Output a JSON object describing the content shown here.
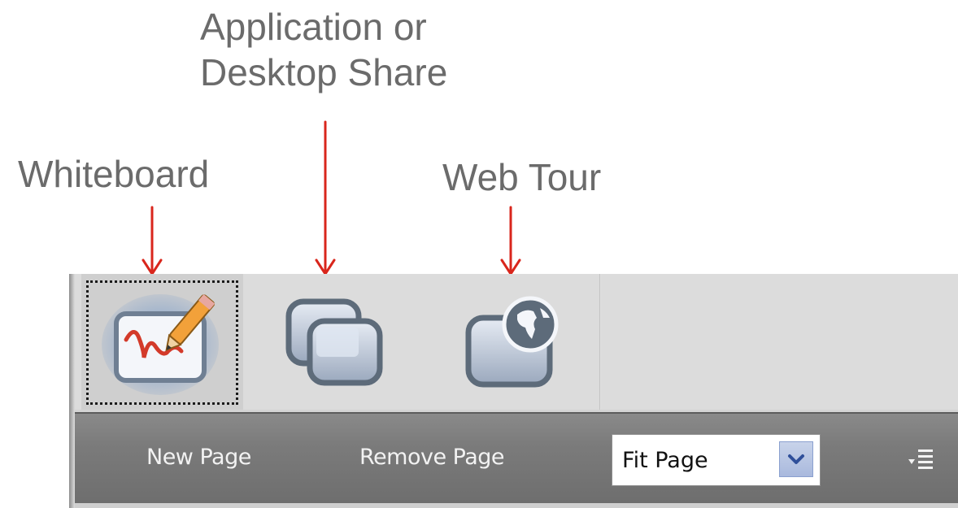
{
  "callouts": {
    "application_line1": "Application or",
    "application_line2": "Desktop Share",
    "whiteboard": "Whiteboard",
    "web_tour": "Web Tour"
  },
  "toolbar": {
    "icons": [
      {
        "name": "whiteboard-icon",
        "selected": true
      },
      {
        "name": "desktop-share-icon",
        "selected": false
      },
      {
        "name": "web-tour-icon",
        "selected": false
      }
    ],
    "new_page": "New Page",
    "remove_page": "Remove Page",
    "zoom_select_value": "Fit Page",
    "menu_icon": "list-menu-icon"
  },
  "colors": {
    "arrow": "#d9261c",
    "callout_text": "#6b6b6b",
    "bar": "#7b7b7b",
    "bar_text": "#f2f2f2"
  }
}
